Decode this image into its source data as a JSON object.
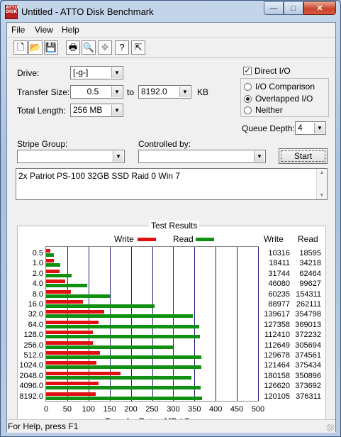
{
  "window": {
    "title": "Untitled - ATTO Disk Benchmark",
    "app_icon_text": "ATTO DISK"
  },
  "caption_buttons": {
    "minimize": "—",
    "maximize": "□",
    "close": "✕"
  },
  "menu": {
    "file": "File",
    "view": "View",
    "help": "Help"
  },
  "toolbar": {
    "icons": [
      "new-icon",
      "open-icon",
      "save-icon",
      "print-icon",
      "print-preview-icon",
      "move-icon",
      "help-icon",
      "context-help-icon"
    ]
  },
  "form": {
    "drive_label": "Drive:",
    "drive_value": "[-g-]",
    "transfer_size_label": "Transfer Size:",
    "transfer_from": "0.5",
    "transfer_to_label": "to",
    "transfer_to": "8192.0",
    "transfer_unit": "KB",
    "total_length_label": "Total Length:",
    "total_length_value": "256 MB",
    "direct_io_label": "Direct I/O",
    "io_comparison_label": "I/O Comparison",
    "overlapped_io_label": "Overlapped I/O",
    "neither_label": "Neither",
    "queue_depth_label": "Queue Depth:",
    "queue_depth_value": "4",
    "stripe_group_label": "Stripe Group:",
    "controlled_by_label": "Controlled by:",
    "start_label": "Start",
    "description": "2x Patriot PS-100 32GB SSD Raid 0 Win 7"
  },
  "results": {
    "title": "Test Results",
    "legend_write": "Write",
    "legend_read": "Read",
    "col_write": "Write",
    "col_read": "Read",
    "x_title": "Transfer Rate - MB / Sec",
    "write_color": "#e01010",
    "read_color": "#109010"
  },
  "chart_data": {
    "type": "bar",
    "orientation": "horizontal",
    "xlabel": "Transfer Rate - MB / Sec",
    "xlim": [
      0,
      500
    ],
    "xticks": [
      "0",
      "50",
      "100",
      "150",
      "200",
      "250",
      "300",
      "350",
      "400",
      "450",
      "500"
    ],
    "categories": [
      "0.5",
      "1.0",
      "2.0",
      "4.0",
      "8.0",
      "16.0",
      "32.0",
      "64.0",
      "128.0",
      "256.0",
      "512.0",
      "1024.0",
      "2048.0",
      "4096.0",
      "8192.0"
    ],
    "series": [
      {
        "name": "Write",
        "values_kb": [
          "10316",
          "18411",
          "31744",
          "46080",
          "60235",
          "88977",
          "139617",
          "127358",
          "112410",
          "112649",
          "129678",
          "121464",
          "180158",
          "126620",
          "120105"
        ],
        "values_mb": [
          10.1,
          18.0,
          31.0,
          45.0,
          58.8,
          86.9,
          136.3,
          124.4,
          109.8,
          110.0,
          126.6,
          118.6,
          175.9,
          123.7,
          117.3
        ]
      },
      {
        "name": "Read",
        "values_kb": [
          "18595",
          "34218",
          "62464",
          "99627",
          "154311",
          "262111",
          "354798",
          "369013",
          "372232",
          "305694",
          "374561",
          "375434",
          "350896",
          "373692",
          "376311"
        ],
        "values_mb": [
          18.2,
          33.4,
          61.0,
          97.3,
          150.7,
          256.0,
          346.5,
          360.4,
          363.5,
          298.5,
          365.8,
          366.6,
          342.7,
          364.9,
          367.5
        ]
      }
    ]
  },
  "status": {
    "text": "For Help, press F1"
  }
}
